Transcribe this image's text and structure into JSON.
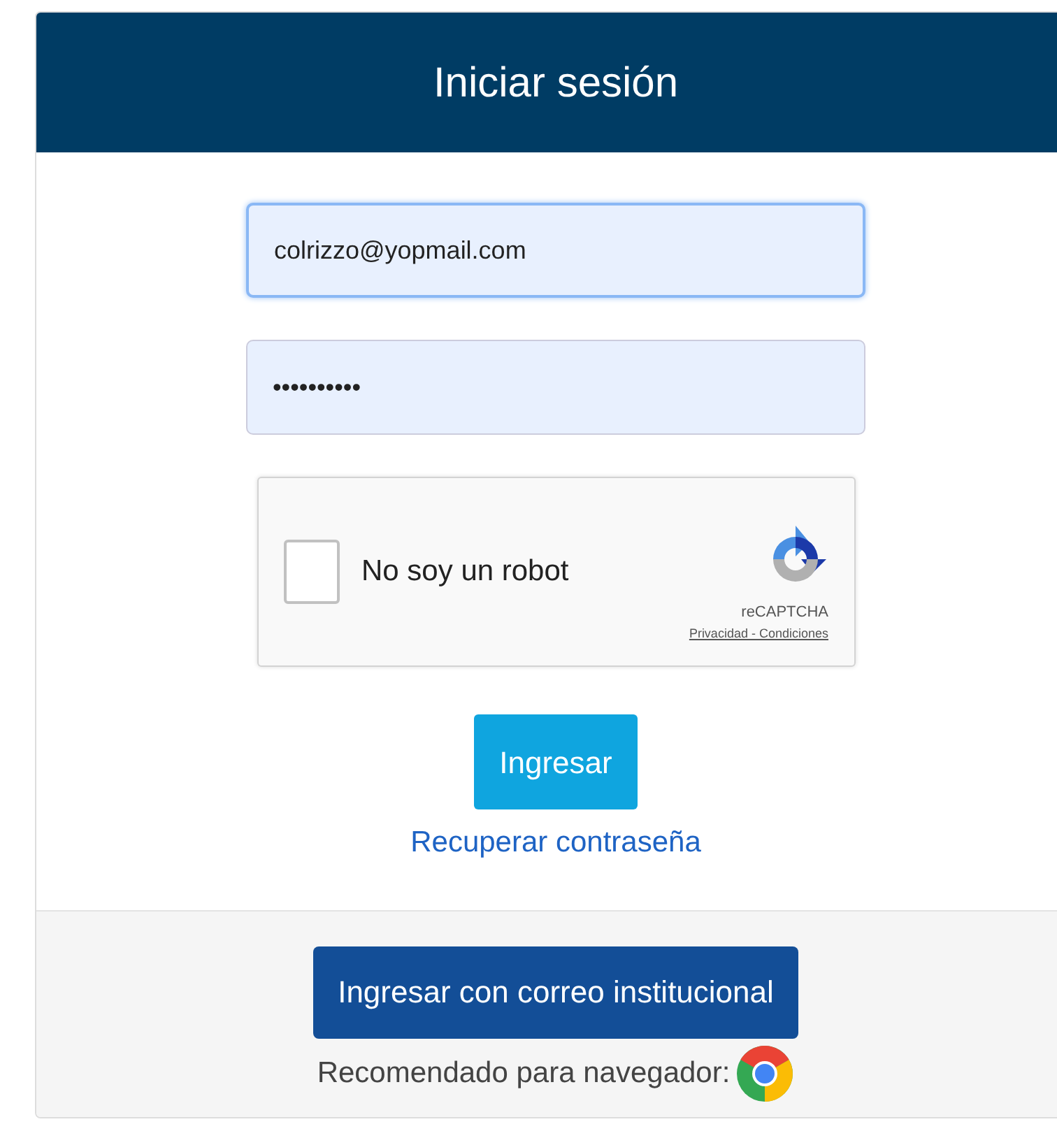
{
  "header": {
    "title": "Iniciar sesión"
  },
  "fields": [
    {
      "value": "colrizzo@yopmail.com",
      "focused": true
    },
    {
      "value": "••••••••••",
      "focused": false
    }
  ],
  "captcha": {
    "label": "No soy un robot",
    "checked": false,
    "brand": "reCAPTCHA",
    "links": "Privacidad - Condiciones"
  },
  "submit_button": "Ingresar",
  "recover_link": "Recuperar contraseña",
  "footer": {
    "button": "Ingresar con correo institucional",
    "note": "Recomendado para navegador:"
  }
}
